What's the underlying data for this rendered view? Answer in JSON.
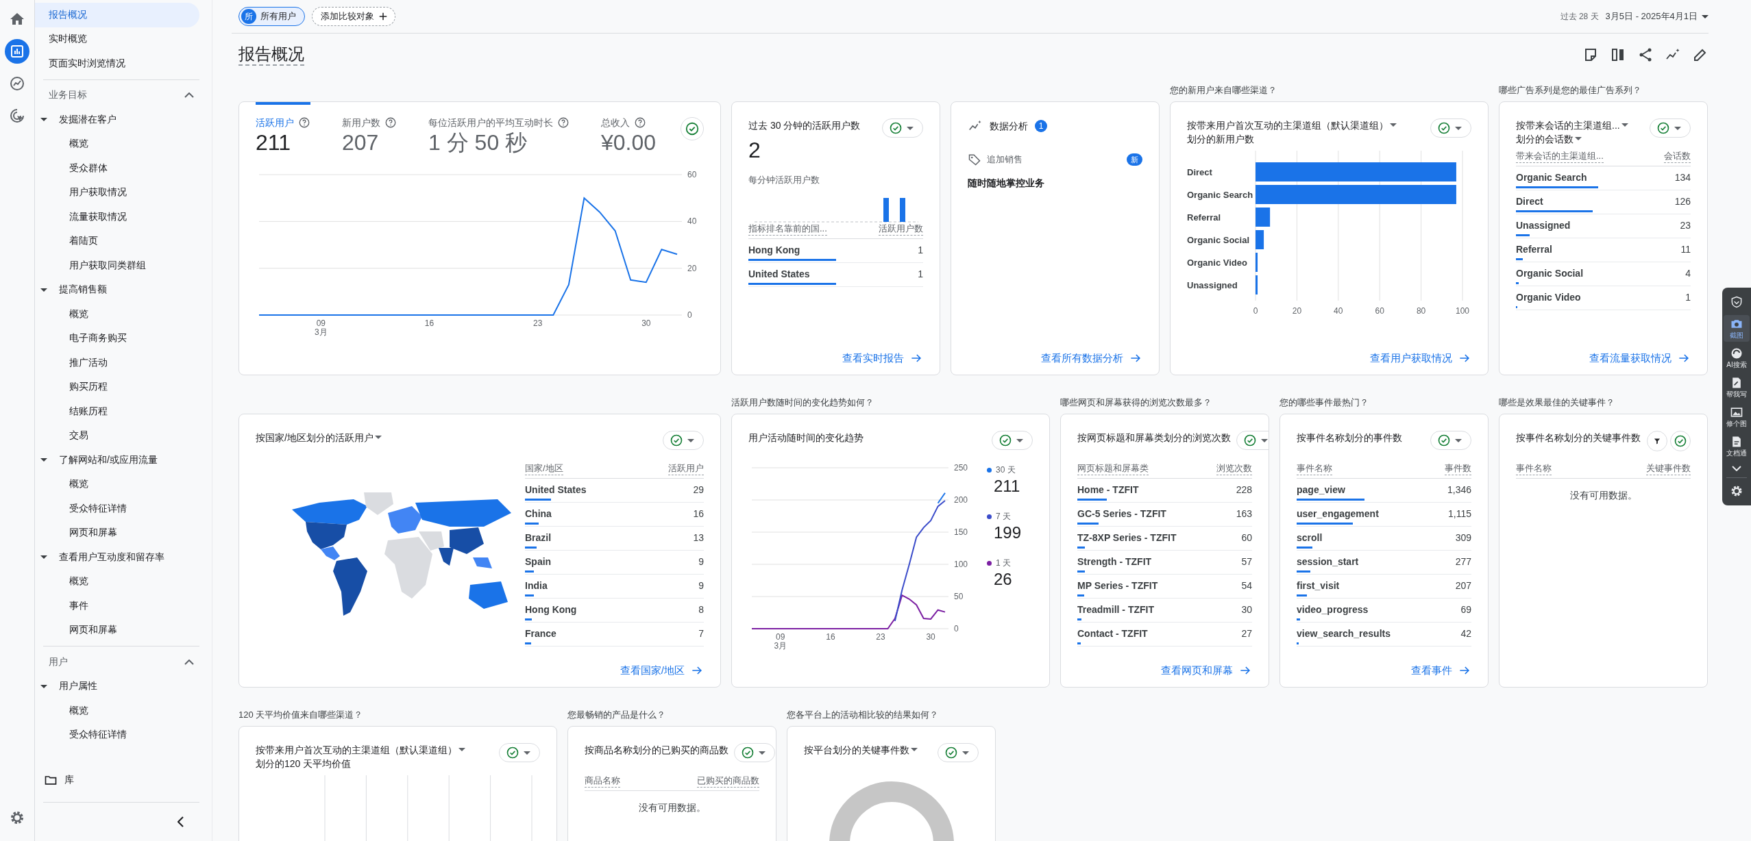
{
  "rail": {
    "items": [
      {
        "selected": false
      },
      {
        "selected": true
      },
      {
        "selected": false
      },
      {
        "selected": false
      }
    ]
  },
  "sidebar": {
    "items": [
      {
        "label": "报告概况",
        "selected": true
      },
      {
        "label": "实时概览",
        "selected": false
      },
      {
        "label": "页面实时浏览情况",
        "selected": false
      }
    ],
    "sections": [
      {
        "title": "业务目标",
        "expanded": true,
        "groups": [
          {
            "label": "发掘潜在客户",
            "expanded": true,
            "children": [
              {
                "label": "概览",
                "selected": false
              },
              {
                "label": "受众群体",
                "selected": false
              },
              {
                "label": "用户获取情况",
                "selected": false
              },
              {
                "label": "流量获取情况",
                "selected": false
              },
              {
                "label": "着陆页",
                "selected": false
              },
              {
                "label": "用户获取同类群组",
                "selected": false
              }
            ]
          },
          {
            "label": "提高销售额",
            "expanded": true,
            "children": [
              {
                "label": "概览",
                "selected": false
              },
              {
                "label": "电子商务购买",
                "selected": false
              },
              {
                "label": "推广活动",
                "selected": false
              },
              {
                "label": "购买历程",
                "selected": false
              },
              {
                "label": "结账历程",
                "selected": false
              },
              {
                "label": "交易",
                "selected": false
              }
            ]
          },
          {
            "label": "了解网站和/或应用流量",
            "expanded": true,
            "children": [
              {
                "label": "概览",
                "selected": false
              },
              {
                "label": "受众特征详情",
                "selected": false
              },
              {
                "label": "网页和屏幕",
                "selected": false
              }
            ]
          },
          {
            "label": "查看用户互动度和留存率",
            "expanded": true,
            "children": [
              {
                "label": "概览",
                "selected": false
              },
              {
                "label": "事件",
                "selected": false
              },
              {
                "label": "网页和屏幕",
                "selected": false
              }
            ]
          }
        ]
      },
      {
        "title": "用户",
        "expanded": true,
        "groups": [
          {
            "label": "用户属性",
            "expanded": true,
            "children": [
              {
                "label": "概览",
                "selected": false
              },
              {
                "label": "受众特征详情",
                "selected": false
              }
            ]
          }
        ]
      }
    ],
    "library": "库"
  },
  "segments": {
    "avatar": "所",
    "label": "所有用户",
    "add_comparison": "添加比较对象"
  },
  "date_range": {
    "prefix": "过去 28 天",
    "range": "3月5日 - 2025年4月1日"
  },
  "page_title": "报告概况",
  "rows": [
    {
      "cards": [
        {
          "kind": "kpi",
          "control": {
            "kind": "check"
          },
          "metrics": [
            {
              "label": "活跃用户",
              "value": "211",
              "selected": true
            },
            {
              "label": "新用户数",
              "value": "207",
              "selected": false
            },
            {
              "label": "每位活跃用户的平均互动时长",
              "value": "1 分 50 秒",
              "selected": false
            },
            {
              "label": "总收入",
              "value": "¥0.00",
              "selected": false
            }
          ],
          "chart_data": {
            "type": "line",
            "grid": true,
            "categories": [
              null,
              null,
              null,
              null,
              "09 3月",
              null,
              null,
              null,
              null,
              null,
              null,
              "16",
              null,
              null,
              null,
              null,
              null,
              null,
              "23",
              null,
              null,
              null,
              null,
              null,
              null,
              "30",
              null,
              null
            ],
            "ylim": [
              0,
              60
            ],
            "yticks": [
              0,
              20,
              40,
              60
            ],
            "values": [
              0,
              0,
              0,
              0,
              0,
              0,
              0,
              0,
              0,
              0,
              0,
              0,
              0,
              0,
              0,
              0,
              0,
              0,
              0,
              0,
              13,
              50,
              44,
              36,
              15,
              14,
              28,
              26
            ]
          }
        },
        {
          "kind": "realtime",
          "control": {
            "kind": "menu"
          },
          "title": [
            {
              "text": "过去 30 分钟的活跃用户数",
              "dropdown": false
            }
          ],
          "value": "2",
          "subtitle": "每分钟活跃用户数",
          "columns": [
            "指标排名靠前的国...",
            "活跃用户数"
          ],
          "rows": [
            {
              "label": "Hong Kong",
              "value": "1",
              "level": 0.5
            },
            {
              "label": "United States",
              "value": "1",
              "level": 0.5
            }
          ],
          "link": "查看实时报告"
        },
        {
          "kind": "insights",
          "title": "数据分析",
          "badge": "1",
          "items": [
            {
              "tag": "追加销售",
              "badge": "新",
              "text": "随时随地掌控业务"
            }
          ],
          "link": "查看所有数据分析"
        },
        {
          "kind": "bar",
          "question": "您的新用户来自哪些渠道？",
          "control": {
            "kind": "menu"
          },
          "title": [
            {
              "text": "按带来用户首次互动的主渠道组（默认渠道组）",
              "dropdown": true
            },
            {
              "text": "划分的新用户数",
              "dropdown": false
            }
          ],
          "chart_data": {
            "type": "bar",
            "orientation": "horizontal",
            "grid": true,
            "categories": [
              "Direct",
              "Organic Search",
              "Referral",
              "Organic Social",
              "Organic Video",
              "Unassigned"
            ],
            "values": [
              97,
              97,
              7,
              4,
              1,
              1
            ],
            "xlim": [
              0,
              100
            ],
            "xticks": [
              0,
              20,
              40,
              60,
              80,
              100
            ]
          },
          "link": "查看用户获取情况"
        },
        {
          "kind": "table",
          "question": "哪些广告系列是您的最佳广告系列？",
          "control": {
            "kind": "menu"
          },
          "title": [
            {
              "text": "按带来会话的主渠道组...",
              "dropdown": true
            },
            {
              "text": "划分的会话数",
              "dropdown": true
            }
          ],
          "columns": [
            "带来会话的主渠道组...",
            "会话数"
          ],
          "rows": [
            {
              "label": "Organic Search",
              "value": "134",
              "level": 0.47
            },
            {
              "label": "Direct",
              "value": "126",
              "level": 0.44
            },
            {
              "label": "Unassigned",
              "value": "23",
              "level": 0.08
            },
            {
              "label": "Referral",
              "value": "11",
              "level": 0.04
            },
            {
              "label": "Organic Social",
              "value": "4",
              "level": 0.015
            },
            {
              "label": "Organic Video",
              "value": "1",
              "level": 0.005
            }
          ],
          "link": "查看流量获取情况"
        }
      ]
    },
    {
      "cards": [
        {
          "kind": "map",
          "control": {
            "kind": "menu"
          },
          "title": [
            {
              "text": "按国家/地区划分的活跃用户",
              "dropdown": true
            }
          ],
          "columns": [
            "国家/地区",
            "活跃用户"
          ],
          "rows": [
            {
              "label": "United States",
              "value": "29",
              "level": 0.147
            },
            {
              "label": "China",
              "value": "16",
              "level": 0.076
            },
            {
              "label": "Brazil",
              "value": "13",
              "level": 0.065
            },
            {
              "label": "Spain",
              "value": "9",
              "level": 0.05
            },
            {
              "label": "India",
              "value": "9",
              "level": 0.05
            },
            {
              "label": "Hong Kong",
              "value": "8",
              "level": 0.04
            },
            {
              "label": "France",
              "value": "7",
              "level": 0.035
            }
          ],
          "link": "查看国家/地区"
        },
        {
          "kind": "trend",
          "question": "活跃用户数随时间的变化趋势如何？",
          "control": {
            "kind": "menu"
          },
          "title": [
            {
              "text": "用户活动随时间的变化趋势",
              "dropdown": false
            }
          ],
          "chart_data": {
            "type": "line",
            "grid": true,
            "categories": [
              null,
              null,
              null,
              null,
              "09 3月",
              null,
              null,
              null,
              null,
              null,
              null,
              "16",
              null,
              null,
              null,
              null,
              null,
              null,
              "23",
              null,
              null,
              null,
              null,
              null,
              null,
              "30",
              null,
              null
            ],
            "ylim": [
              0,
              250
            ],
            "yticks": [
              0,
              50,
              100,
              150,
              200,
              250
            ],
            "series": [
              {
                "name": "30 天",
                "color": "#1a73e8",
                "values": [
                  null,
                  null,
                  null,
                  null,
                  null,
                  null,
                  null,
                  null,
                  null,
                  null,
                  null,
                  null,
                  null,
                  null,
                  null,
                  null,
                  null,
                  null,
                  null,
                  null,
                  null,
                  null,
                  null,
                  null,
                  null,
                  null,
                  195,
                  211
                ]
              },
              {
                "name": "7 天",
                "color": "#3b4cca",
                "values": [
                  null,
                  null,
                  null,
                  null,
                  null,
                  null,
                  null,
                  null,
                  null,
                  null,
                  null,
                  null,
                  null,
                  null,
                  null,
                  null,
                  null,
                  null,
                  null,
                  null,
                  12,
                  60,
                  100,
                  142,
                  157,
                  168,
                  190,
                  199
                ]
              },
              {
                "name": "1 天",
                "color": "#7b1fa2",
                "values": [
                  0,
                  0,
                  0,
                  0,
                  0,
                  0,
                  0,
                  0,
                  0,
                  0,
                  0,
                  0,
                  0,
                  0,
                  0,
                  0,
                  0,
                  0,
                  0,
                  0,
                  16,
                  52,
                  46,
                  37,
                  16,
                  15,
                  29,
                  26
                ]
              }
            ]
          },
          "totals": [
            "211",
            "199",
            "26"
          ]
        },
        {
          "kind": "table",
          "question": "哪些网页和屏幕获得的浏览次数最多？",
          "control": {
            "kind": "menu"
          },
          "title": [
            {
              "text": "按网页标题和屏幕类划分的浏览次数",
              "dropdown": false
            }
          ],
          "columns": [
            "网页标题和屏幕类",
            "浏览次数"
          ],
          "rows": [
            {
              "label": "Home - TZFIT",
              "value": "228",
              "level": 0.17
            },
            {
              "label": "GC-5 Series - TZFIT",
              "value": "163",
              "level": 0.12
            },
            {
              "label": "TZ-8XP Series - TZFIT",
              "value": "60",
              "level": 0.045
            },
            {
              "label": "Strength - TZFIT",
              "value": "57",
              "level": 0.043
            },
            {
              "label": "MP Series - TZFIT",
              "value": "54",
              "level": 0.04
            },
            {
              "label": "Treadmill - TZFIT",
              "value": "30",
              "level": 0.023
            },
            {
              "label": "Contact - TZFIT",
              "value": "27",
              "level": 0.02
            }
          ],
          "link": "查看网页和屏幕"
        },
        {
          "kind": "table",
          "question": "您的哪些事件最热门？",
          "control": {
            "kind": "menu"
          },
          "title": [
            {
              "text": "按事件名称划分的事件数",
              "dropdown": false
            }
          ],
          "columns": [
            "事件名称",
            "事件数"
          ],
          "rows": [
            {
              "label": "page_view",
              "value": "1,346",
              "level": 0.39
            },
            {
              "label": "user_engagement",
              "value": "1,115",
              "level": 0.32
            },
            {
              "label": "scroll",
              "value": "309",
              "level": 0.09
            },
            {
              "label": "session_start",
              "value": "277",
              "level": 0.08
            },
            {
              "label": "first_visit",
              "value": "207",
              "level": 0.06
            },
            {
              "label": "video_progress",
              "value": "69",
              "level": 0.02
            },
            {
              "label": "view_search_results",
              "value": "42",
              "level": 0.012
            }
          ],
          "link": "查看事件"
        },
        {
          "kind": "table",
          "question": "哪些是效果最佳的关键事件？",
          "control": {
            "kind": "filter"
          },
          "title": [
            {
              "text": "按事件名称划分的关键事件数",
              "dropdown": false
            }
          ],
          "columns": [
            "事件名称",
            "关键事件数"
          ],
          "empty": "没有可用数据。"
        }
      ]
    },
    {
      "cards": [
        {
          "kind": "grid",
          "question": "120 天平均价值来自哪些渠道？",
          "control": {
            "kind": "menu"
          },
          "title": [
            {
              "text": "按带来用户首次互动的主渠道组（默认渠道组）",
              "dropdown": true
            },
            {
              "text": "划分的120 天平均价值",
              "dropdown": false
            }
          ]
        },
        {
          "kind": "table",
          "question": "您最畅销的产品是什么？",
          "control": {
            "kind": "menu"
          },
          "title": [
            {
              "text": "按商品名称划分的已购买的商品数",
              "dropdown": false
            }
          ],
          "columns": [
            "商品名称",
            "已购买的商品数"
          ],
          "empty": "没有可用数据。"
        },
        {
          "kind": "donut",
          "question": "您各平台上的活动相比较的结果如何？",
          "control": {
            "kind": "menu"
          },
          "title": [
            {
              "text": "按平台划分的关键事件数",
              "dropdown": true
            }
          ]
        }
      ]
    }
  ],
  "assistant_toolbar": {
    "items": [
      {
        "label": "截图",
        "selected": true
      },
      {
        "label": "AI搜索",
        "selected": false
      },
      {
        "label": "帮我写",
        "selected": false
      },
      {
        "label": "修个图",
        "selected": false
      },
      {
        "label": "文档通",
        "selected": false
      }
    ]
  }
}
